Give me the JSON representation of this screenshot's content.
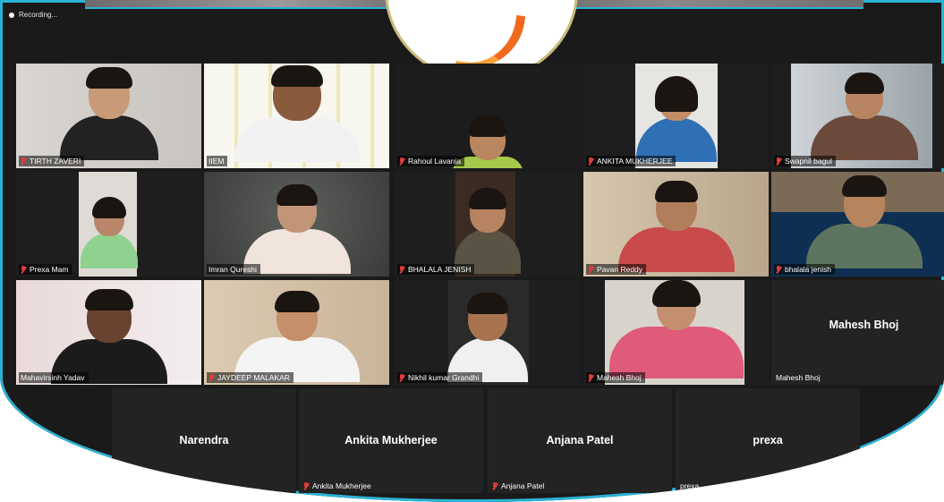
{
  "meeting": {
    "recording_label": "Recording...",
    "accent_color": "#2bb3d6",
    "speaker_highlight": "#b8e02a"
  },
  "participants": [
    {
      "name": "TIRTH ZAVERI",
      "muted": true,
      "video": true
    },
    {
      "name": "IIEM",
      "muted": false,
      "video": true,
      "speaking": true
    },
    {
      "name": "Rahoul Lavania",
      "muted": true,
      "video": true
    },
    {
      "name": "ANKITA MUKHERJEE",
      "muted": true,
      "video": true
    },
    {
      "name": "Swapnil bagul",
      "muted": true,
      "video": true
    },
    {
      "name": "Prexa Mam",
      "muted": true,
      "video": true
    },
    {
      "name": "Imran Qureshi",
      "muted": false,
      "video": true
    },
    {
      "name": "BHALALA JENISH",
      "muted": true,
      "video": true
    },
    {
      "name": "Pavan Reddy",
      "muted": true,
      "video": true
    },
    {
      "name": "bhalala jenish",
      "muted": true,
      "video": true
    },
    {
      "name": "Mahavirsinh Yadav",
      "muted": false,
      "video": true
    },
    {
      "name": "JAYDEEP MALAKAR",
      "muted": true,
      "video": true
    },
    {
      "name": "Nikhil kumar Grandhi",
      "muted": true,
      "video": true
    },
    {
      "name": "Mahesh Bhoj",
      "muted": true,
      "video": true
    },
    {
      "name": "Mahesh Bhoj",
      "muted": false,
      "video": false,
      "display_name": "Mahesh Bhoj"
    },
    {
      "name": "ndra",
      "muted": false,
      "video": false,
      "display_name": "Narendra"
    },
    {
      "name": "Ankita Mukherjee",
      "muted": true,
      "video": false,
      "display_name": "Ankita Mukherjee"
    },
    {
      "name": "Anjana Patel",
      "muted": true,
      "video": false,
      "display_name": "Anjana Patel"
    },
    {
      "name": "prexa",
      "muted": false,
      "video": false,
      "display_name": "prexa"
    }
  ]
}
